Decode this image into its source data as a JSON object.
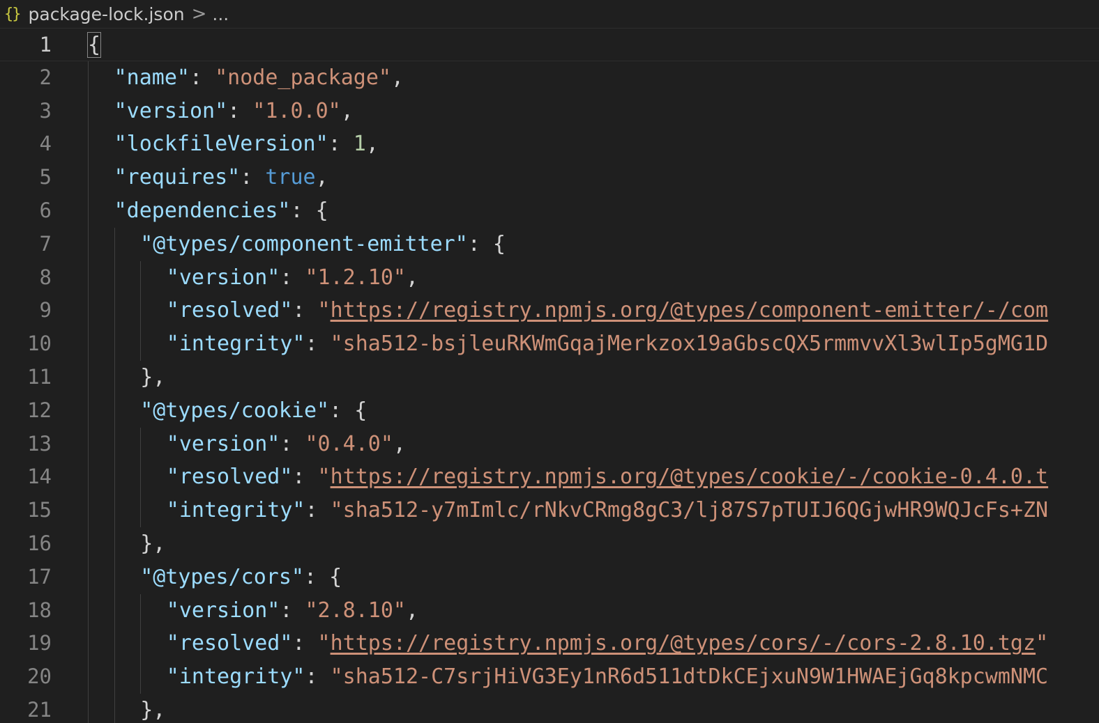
{
  "breadcrumb": {
    "icon": "json-braces-icon",
    "icon_glyph": "{}",
    "file": "package-lock.json",
    "separator": ">",
    "rest": "..."
  },
  "editor": {
    "current_line": 1,
    "lines": [
      {
        "n": "1",
        "indent": 0,
        "tokens": [
          {
            "t": "p",
            "v": "{"
          }
        ]
      },
      {
        "n": "2",
        "indent": 1,
        "tokens": [
          {
            "t": "k",
            "v": "\"name\""
          },
          {
            "t": "p",
            "v": ": "
          },
          {
            "t": "s",
            "v": "\"node_package\""
          },
          {
            "t": "p",
            "v": ","
          }
        ]
      },
      {
        "n": "3",
        "indent": 1,
        "tokens": [
          {
            "t": "k",
            "v": "\"version\""
          },
          {
            "t": "p",
            "v": ": "
          },
          {
            "t": "s",
            "v": "\"1.0.0\""
          },
          {
            "t": "p",
            "v": ","
          }
        ]
      },
      {
        "n": "4",
        "indent": 1,
        "tokens": [
          {
            "t": "k",
            "v": "\"lockfileVersion\""
          },
          {
            "t": "p",
            "v": ": "
          },
          {
            "t": "n",
            "v": "1"
          },
          {
            "t": "p",
            "v": ","
          }
        ]
      },
      {
        "n": "5",
        "indent": 1,
        "tokens": [
          {
            "t": "k",
            "v": "\"requires\""
          },
          {
            "t": "p",
            "v": ": "
          },
          {
            "t": "b",
            "v": "true"
          },
          {
            "t": "p",
            "v": ","
          }
        ]
      },
      {
        "n": "6",
        "indent": 1,
        "tokens": [
          {
            "t": "k",
            "v": "\"dependencies\""
          },
          {
            "t": "p",
            "v": ": {"
          }
        ]
      },
      {
        "n": "7",
        "indent": 2,
        "tokens": [
          {
            "t": "k",
            "v": "\"@types/component-emitter\""
          },
          {
            "t": "p",
            "v": ": {"
          }
        ]
      },
      {
        "n": "8",
        "indent": 3,
        "tokens": [
          {
            "t": "k",
            "v": "\"version\""
          },
          {
            "t": "p",
            "v": ": "
          },
          {
            "t": "s",
            "v": "\"1.2.10\""
          },
          {
            "t": "p",
            "v": ","
          }
        ]
      },
      {
        "n": "9",
        "indent": 3,
        "tokens": [
          {
            "t": "k",
            "v": "\"resolved\""
          },
          {
            "t": "p",
            "v": ": "
          },
          {
            "t": "s",
            "v": "\""
          },
          {
            "t": "u",
            "v": "https://registry.npmjs.org/@types/component-emitter/-/com"
          }
        ]
      },
      {
        "n": "10",
        "indent": 3,
        "tokens": [
          {
            "t": "k",
            "v": "\"integrity\""
          },
          {
            "t": "p",
            "v": ": "
          },
          {
            "t": "s",
            "v": "\"sha512-bsjleuRKWmGqajMerkzox19aGbscQX5rmmvvXl3wlIp5gMG1D"
          }
        ]
      },
      {
        "n": "11",
        "indent": 2,
        "tokens": [
          {
            "t": "p",
            "v": "},"
          }
        ]
      },
      {
        "n": "12",
        "indent": 2,
        "tokens": [
          {
            "t": "k",
            "v": "\"@types/cookie\""
          },
          {
            "t": "p",
            "v": ": {"
          }
        ]
      },
      {
        "n": "13",
        "indent": 3,
        "tokens": [
          {
            "t": "k",
            "v": "\"version\""
          },
          {
            "t": "p",
            "v": ": "
          },
          {
            "t": "s",
            "v": "\"0.4.0\""
          },
          {
            "t": "p",
            "v": ","
          }
        ]
      },
      {
        "n": "14",
        "indent": 3,
        "tokens": [
          {
            "t": "k",
            "v": "\"resolved\""
          },
          {
            "t": "p",
            "v": ": "
          },
          {
            "t": "s",
            "v": "\""
          },
          {
            "t": "u",
            "v": "https://registry.npmjs.org/@types/cookie/-/cookie-0.4.0.t"
          }
        ]
      },
      {
        "n": "15",
        "indent": 3,
        "tokens": [
          {
            "t": "k",
            "v": "\"integrity\""
          },
          {
            "t": "p",
            "v": ": "
          },
          {
            "t": "s",
            "v": "\"sha512-y7mImlc/rNkvCRmg8gC3/lj87S7pTUIJ6QGjwHR9WQJcFs+ZN"
          }
        ]
      },
      {
        "n": "16",
        "indent": 2,
        "tokens": [
          {
            "t": "p",
            "v": "},"
          }
        ]
      },
      {
        "n": "17",
        "indent": 2,
        "tokens": [
          {
            "t": "k",
            "v": "\"@types/cors\""
          },
          {
            "t": "p",
            "v": ": {"
          }
        ]
      },
      {
        "n": "18",
        "indent": 3,
        "tokens": [
          {
            "t": "k",
            "v": "\"version\""
          },
          {
            "t": "p",
            "v": ": "
          },
          {
            "t": "s",
            "v": "\"2.8.10\""
          },
          {
            "t": "p",
            "v": ","
          }
        ]
      },
      {
        "n": "19",
        "indent": 3,
        "tokens": [
          {
            "t": "k",
            "v": "\"resolved\""
          },
          {
            "t": "p",
            "v": ": "
          },
          {
            "t": "s",
            "v": "\""
          },
          {
            "t": "u",
            "v": "https://registry.npmjs.org/@types/cors/-/cors-2.8.10.tgz"
          },
          {
            "t": "s",
            "v": "\""
          }
        ]
      },
      {
        "n": "20",
        "indent": 3,
        "tokens": [
          {
            "t": "k",
            "v": "\"integrity\""
          },
          {
            "t": "p",
            "v": ": "
          },
          {
            "t": "s",
            "v": "\"sha512-C7srjHiVG3Ey1nR6d511dtDkCEjxuN9W1HWAEjGq8kpcwmNMC"
          }
        ]
      },
      {
        "n": "21",
        "indent": 2,
        "tokens": [
          {
            "t": "p",
            "v": "},"
          }
        ]
      }
    ]
  },
  "colors": {
    "background": "#1f1f1f",
    "key": "#9cdcfe",
    "string": "#ce9178",
    "number": "#b5cea8",
    "boolean": "#569cd6",
    "punctuation": "#d4d4d4",
    "line_number": "#858585",
    "json_icon": "#cbcb41"
  }
}
